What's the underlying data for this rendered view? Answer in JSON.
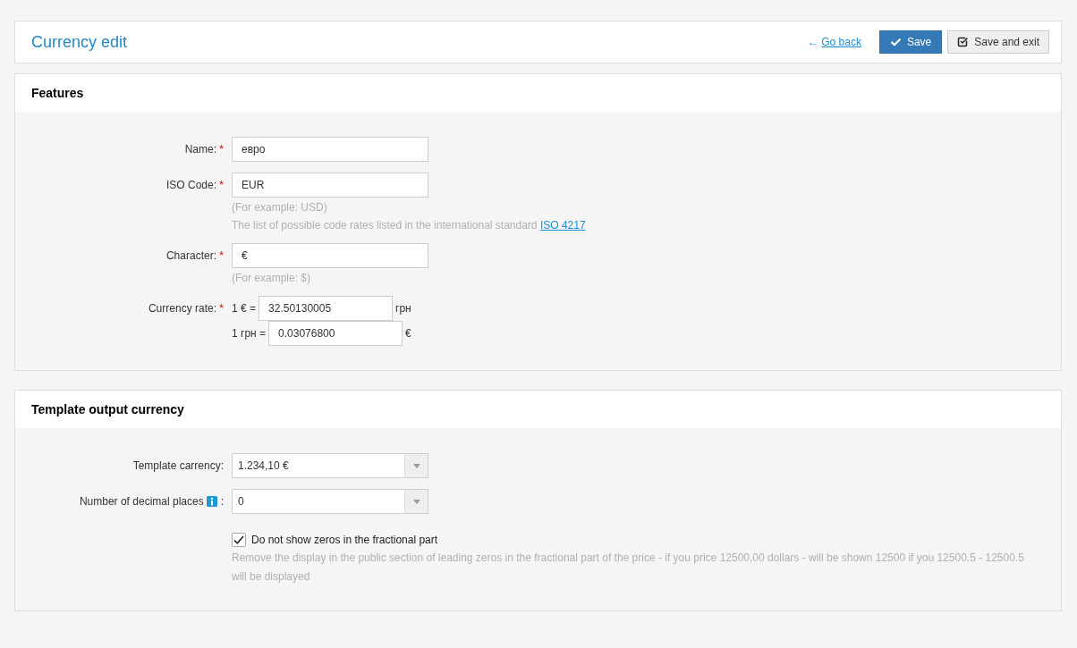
{
  "header": {
    "title": "Currency edit",
    "back_link": {
      "arrow": "←",
      "label": "Go back"
    },
    "buttons": [
      {
        "kind": "primary",
        "label": "Save"
      },
      {
        "kind": "secondary",
        "label": "Save and exit"
      }
    ]
  },
  "panels": [
    {
      "title": "Features",
      "fields": [
        {
          "kind": "text",
          "label": "Name:",
          "required_mark": "*",
          "value": "евро"
        },
        {
          "kind": "text",
          "label": "ISO Code:",
          "required_mark": "*",
          "value": "EUR",
          "hints": [
            {
              "text": "(For example: USD)"
            },
            {
              "text": "The list of possible code rates listed in the international standard",
              "link": "ISO 4217"
            }
          ]
        },
        {
          "kind": "text",
          "label": "Character:",
          "required_mark": "*",
          "value": "€",
          "hints": [
            {
              "text": "(For example: $)"
            }
          ]
        },
        {
          "kind": "rate",
          "label": "Currency rate:",
          "required_mark": "*",
          "rates": [
            {
              "prefix": "1 € =",
              "value": "32.50130005",
              "suffix": "грн"
            },
            {
              "prefix": "1 грн =",
              "value": "0.03076800",
              "suffix": "€"
            }
          ]
        }
      ]
    },
    {
      "title": "Template output currency",
      "fields": [
        {
          "kind": "select",
          "label": "Template carrency:",
          "value": "1.234,10 €"
        },
        {
          "kind": "select",
          "label": "Number of decimal places",
          "info": true,
          "label_suffix": ":",
          "value": "0"
        },
        {
          "kind": "checkbox",
          "label": "Do not show zeros in the fractional part",
          "checked": true,
          "description": "Remove the display in the public section of leading zeros in the fractional part of the price - if you price 12500,00 dollars - will be shown 12500 if you 12500.5 - 12500.5 will be displayed"
        }
      ]
    }
  ]
}
